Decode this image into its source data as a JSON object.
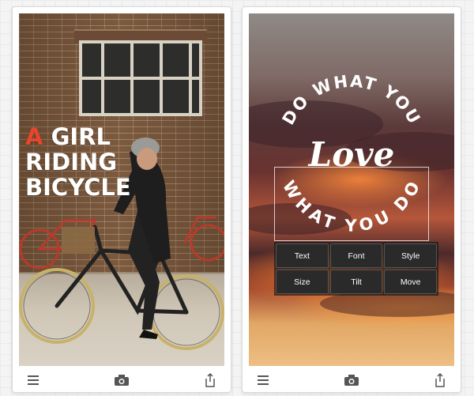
{
  "left_screen": {
    "headline": {
      "accent_word": "A",
      "line1_rest": "GIRL",
      "line2": "RIDING",
      "line3": "BICYCLE"
    },
    "toolbar": {
      "menu_icon": "hamburger-menu-icon",
      "camera_icon": "camera-icon",
      "share_icon": "share-icon"
    }
  },
  "right_screen": {
    "seal_text": {
      "top_arc": "DO WHAT YOU",
      "center": "Love",
      "bottom_arc": "WHAT YOU DO"
    },
    "menu": {
      "items": [
        "Text",
        "Font",
        "Style",
        "Size",
        "Tilt",
        "Move"
      ]
    },
    "toolbar": {
      "menu_icon": "hamburger-menu-icon",
      "camera_icon": "camera-icon",
      "share_icon": "share-icon"
    }
  },
  "colors": {
    "accent_red": "#e8452c",
    "menu_bg": "#2a2a2a",
    "toolbar_icon": "#555555"
  }
}
